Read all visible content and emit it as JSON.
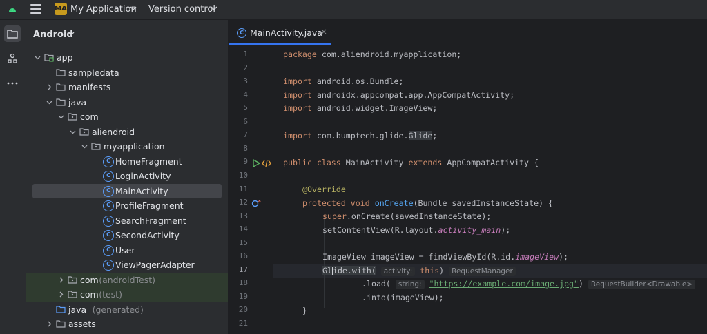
{
  "topbar": {
    "project_badge": "MA",
    "project_name": "My Application",
    "vcs_label": "Version control"
  },
  "panel": {
    "title": "Android",
    "tree": [
      {
        "label": "app",
        "kind": "module",
        "indent": 0,
        "arrow": "down"
      },
      {
        "label": "sampledata",
        "kind": "folder",
        "indent": 1,
        "arrow": "none"
      },
      {
        "label": "manifests",
        "kind": "folder",
        "indent": 1,
        "arrow": "right"
      },
      {
        "label": "java",
        "kind": "folder",
        "indent": 1,
        "arrow": "down"
      },
      {
        "label": "com",
        "kind": "package",
        "indent": 2,
        "arrow": "down"
      },
      {
        "label": "aliendroid",
        "kind": "package",
        "indent": 3,
        "arrow": "down"
      },
      {
        "label": "myapplication",
        "kind": "package",
        "indent": 4,
        "arrow": "down"
      },
      {
        "label": "HomeFragment",
        "kind": "class",
        "indent": 5,
        "arrow": "none"
      },
      {
        "label": "LoginActivity",
        "kind": "class",
        "indent": 5,
        "arrow": "none"
      },
      {
        "label": "MainActivity",
        "kind": "class",
        "indent": 5,
        "arrow": "none",
        "selected": true
      },
      {
        "label": "ProfileFragment",
        "kind": "class",
        "indent": 5,
        "arrow": "none"
      },
      {
        "label": "SearchFragment",
        "kind": "class",
        "indent": 5,
        "arrow": "none"
      },
      {
        "label": "SecondActivity",
        "kind": "class",
        "indent": 5,
        "arrow": "none"
      },
      {
        "label": "User",
        "kind": "class",
        "indent": 5,
        "arrow": "none"
      },
      {
        "label": "ViewPagerAdapter",
        "kind": "class",
        "indent": 5,
        "arrow": "none"
      },
      {
        "label": "com",
        "suffix": "(androidTest)",
        "kind": "package",
        "indent": 2,
        "arrow": "right",
        "test": true
      },
      {
        "label": "com",
        "suffix": "(test)",
        "kind": "package",
        "indent": 2,
        "arrow": "right",
        "test": true
      },
      {
        "label": "java",
        "suffix": "(generated)",
        "kind": "folder-gen",
        "indent": 1,
        "arrow": "none"
      },
      {
        "label": "assets",
        "kind": "folder",
        "indent": 1,
        "arrow": "right"
      }
    ]
  },
  "editor": {
    "tab_title": "MainActivity.java",
    "tab_close": "×",
    "current_line": 17,
    "lines": [
      "1",
      "2",
      "3",
      "4",
      "5",
      "6",
      "7",
      "8",
      "9",
      "10",
      "11",
      "12",
      "13",
      "14",
      "15",
      "16",
      "17",
      "18",
      "19",
      "20",
      "21"
    ],
    "code": {
      "l1_kw": "package",
      "l1_rest": " com.aliendroid.myapplication;",
      "l3_kw": "import",
      "l3_rest": " android.os.Bundle;",
      "l4_kw": "import",
      "l4_rest": " androidx.appcompat.app.AppCompatActivity;",
      "l5_kw": "import",
      "l5_rest": " android.widget.ImageView;",
      "l7_kw": "import",
      "l7_rest": " com.bumptech.glide.",
      "l7_glide": "Glide",
      "l7_end": ";",
      "l9_kw1": "public class",
      "l9_name": " MainActivity ",
      "l9_kw2": "extends",
      "l9_rest": " AppCompatActivity {",
      "l11_ann": "@Override",
      "l12_kw": "protected void",
      "l12_fn": " onCreate",
      "l12_rest": "(Bundle savedInstanceState) {",
      "l13_kw": "super",
      "l13_rest": ".onCreate(savedInstanceState);",
      "l14_rest": "setContentView(R.layout.",
      "l14_it": "activity_main",
      "l14_end": ");",
      "l16_rest": "ImageView imageView = findViewById(R.id.",
      "l16_it": "imageView",
      "l16_end": ");",
      "l17_a": "Gl",
      "l17_b": "ide.with(",
      "l17_hint1": "activity:",
      "l17_kw": "this",
      "l17_end": ")",
      "l17_hint2": "RequestManager",
      "l18_a": ".load(",
      "l18_hint1": "string:",
      "l18_str": "\"https://example.com/image.jpg\"",
      "l18_end": ")",
      "l18_hint2": "RequestBuilder<Drawable>",
      "l19": ".into(imageView);",
      "l20": "}"
    }
  }
}
